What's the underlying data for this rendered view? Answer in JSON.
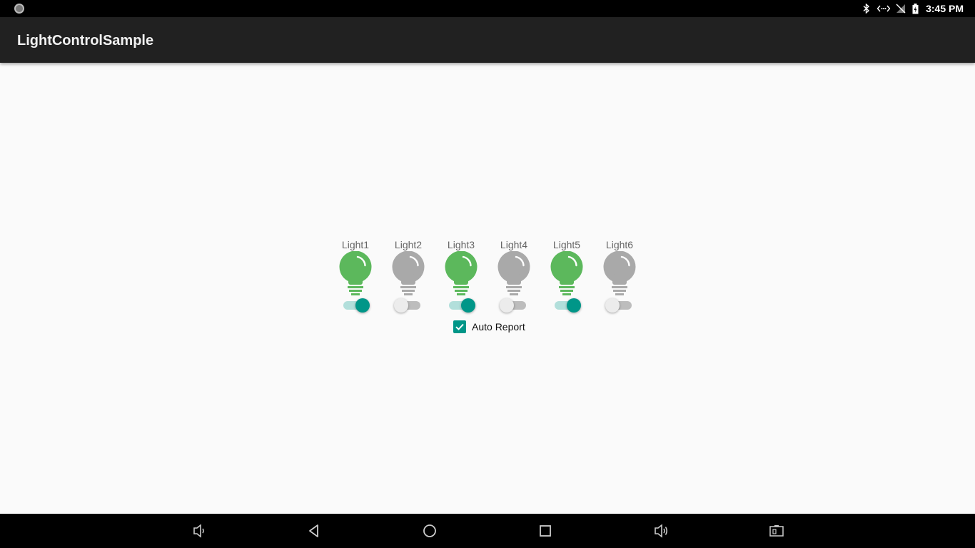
{
  "status_bar": {
    "time": "3:45 PM",
    "icons": [
      "bluetooth-icon",
      "data-transfer-icon",
      "no-signal-icon",
      "battery-icon"
    ]
  },
  "app_bar": {
    "title": "LightControlSample"
  },
  "lights": [
    {
      "label": "Light1",
      "on": true
    },
    {
      "label": "Light2",
      "on": false
    },
    {
      "label": "Light3",
      "on": true
    },
    {
      "label": "Light4",
      "on": false
    },
    {
      "label": "Light5",
      "on": true
    },
    {
      "label": "Light6",
      "on": false
    }
  ],
  "auto_report": {
    "label": "Auto Report",
    "checked": true
  },
  "colors": {
    "bulb_on": "#5cb85c",
    "bulb_off": "#a9a9a9",
    "accent": "#009688",
    "app_bar": "#212121",
    "background": "#fafafa"
  },
  "nav_bar": {
    "buttons": [
      "volume-down-icon",
      "back-icon",
      "home-icon",
      "recents-icon",
      "volume-up-icon",
      "screenshot-icon"
    ]
  }
}
